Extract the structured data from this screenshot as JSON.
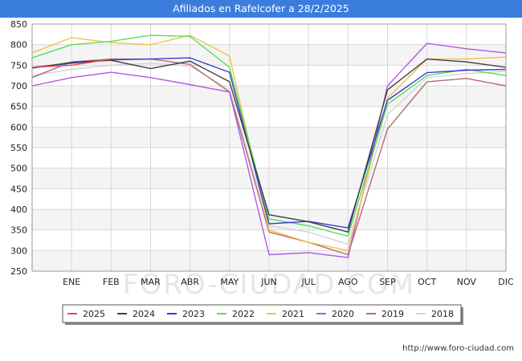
{
  "title": "Afiliados en Rafelcofer a 28/2/2025",
  "watermark": "FORO-CIUDAD.COM",
  "credit": "http://www.foro-ciudad.com",
  "chart_data": {
    "type": "line",
    "categories": [
      "",
      "ENE",
      "FEB",
      "MAR",
      "ABR",
      "MAY",
      "JUN",
      "JUL",
      "AGO",
      "SEP",
      "OCT",
      "NOV",
      "DIC"
    ],
    "ylim": [
      250,
      850
    ],
    "yticks": [
      250,
      300,
      350,
      400,
      450,
      500,
      550,
      600,
      650,
      700,
      750,
      800,
      850
    ],
    "grid": true,
    "legend_position": "bottom",
    "series": [
      {
        "name": "2025",
        "color": "#e8474b",
        "values": [
          745,
          750,
          765,
          null,
          null,
          null,
          null,
          null,
          null,
          null,
          null,
          null,
          null
        ]
      },
      {
        "name": "2024",
        "color": "#404040",
        "values": [
          743,
          757,
          762,
          742,
          760,
          710,
          387,
          370,
          345,
          690,
          765,
          758,
          745
        ]
      },
      {
        "name": "2023",
        "color": "#3b3bd6",
        "values": [
          745,
          755,
          763,
          765,
          768,
          733,
          365,
          371,
          355,
          665,
          732,
          738,
          740
        ]
      },
      {
        "name": "2022",
        "color": "#55e055",
        "values": [
          768,
          800,
          808,
          823,
          820,
          745,
          377,
          360,
          335,
          655,
          725,
          740,
          725
        ]
      },
      {
        "name": "2021",
        "color": "#f5c04a",
        "values": [
          780,
          817,
          805,
          800,
          823,
          772,
          350,
          320,
          300,
          670,
          765,
          765,
          770
        ]
      },
      {
        "name": "2020",
        "color": "#b259e6",
        "values": [
          700,
          720,
          733,
          720,
          703,
          685,
          290,
          295,
          283,
          700,
          803,
          790,
          780
        ]
      },
      {
        "name": "2019",
        "color": "#b56b72",
        "values": [
          720,
          758,
          765,
          765,
          752,
          685,
          345,
          320,
          290,
          595,
          710,
          718,
          700
        ]
      },
      {
        "name": "2018",
        "color": "#d4d4d4",
        "values": [
          725,
          740,
          750,
          755,
          748,
          690,
          360,
          345,
          315,
          630,
          720,
          730,
          735
        ]
      }
    ]
  }
}
